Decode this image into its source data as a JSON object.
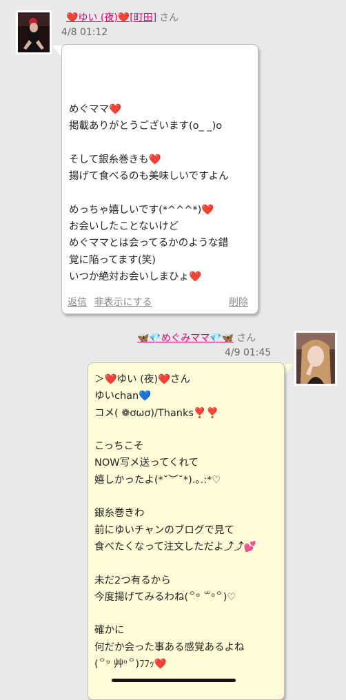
{
  "comment1": {
    "author": "❤️ゆい (夜)❤️[町田]",
    "suffix": "さん",
    "timestamp": "4/8 01:12",
    "lines": [
      "めぐママ❤️",
      "掲載ありがとうございます(o_ _)o",
      "",
      "そして銀糸巻きも❤️",
      "揚げて食べるのも美味しいですよん",
      "",
      "めっちゃ嬉しいです(*^^^*)❤️",
      "お会いしたことないけど",
      "めぐママとは会ってるかのような錯",
      "覚に陥ってます(笑)",
      "いつか絶対お会いしまひょ❤️"
    ],
    "reply_label": "返信",
    "hide_label": "非表示にする",
    "delete_label": "削除"
  },
  "comment2": {
    "author": "🦋💎めぐみママ💎🦋",
    "suffix": "さん",
    "timestamp": "4/9 01:45",
    "lines": [
      "＞❤️ゆい (夜)❤️さん",
      "ゆいchan💙",
      "コメ( ❁ơωơ)/Thanks❣️❣️",
      "",
      "こっちこそ",
      "NOW写メ送ってくれて",
      "嬉しかったよ(*˘︶˘*).｡.:*♡",
      "",
      "銀糸巻きわ",
      "前にゆいチャンのブログで見て",
      "食べたくなって注文しただよ⤴︎⤴︎💕",
      "",
      "未だ2つ有るから",
      "今度揚げてみるわね(꒪ᵒ ꒳ᵒ꒪)♡",
      "",
      "確かに",
      "何だか会った事ある感覚あるよね",
      "(꒪ᵒ 艸ᵒ꒪)ﾌﾌｯ❤️"
    ]
  }
}
